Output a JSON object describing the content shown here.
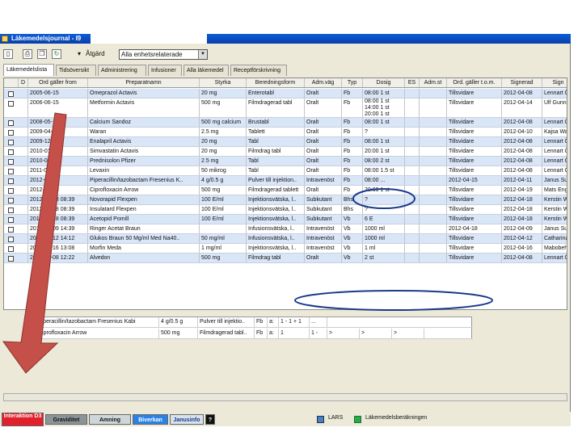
{
  "window": {
    "title": "Läkemedelsjournal - I9"
  },
  "toolbar": {
    "action_label": "Åtgärd",
    "filter_value": "Alla enhetsrelaterade"
  },
  "tabs": [
    "Läkemedelslista",
    "Tidsöversikt",
    "Administrering",
    "Infusioner",
    "Alla läkemedel",
    "Receptförskrivning"
  ],
  "grid": {
    "columns": [
      "",
      "D",
      "Ord gäller from",
      "Preparatnamn",
      "Styrka",
      "Beredningsform",
      "Adm.väg",
      "Typ",
      "Dosig",
      "ES",
      "Adm.st",
      "Ord. gäller t.o.m.",
      "Signerad",
      "Sign"
    ],
    "rows": [
      [
        "",
        "",
        "2005-06-15",
        "Omeprazol Actavis",
        "20 mg",
        "Enterotabl",
        "Oralt",
        "Fb",
        "08:00 1 st",
        "",
        "",
        "Tillsvidare",
        "2012-04-08",
        "Lennart Ö"
      ],
      [
        "",
        "",
        "2006-06-15",
        "Metformin Actavis",
        "500 mg",
        "Filmdragerad tabl",
        "Oralt",
        "Fb",
        "08:00 1 st\n14:00 1 st\n20:00 1 st",
        "",
        "",
        "Tillsvidare",
        "2012-04-14",
        "Ulf Gunnar"
      ],
      [
        "",
        "",
        "2008-05-15",
        "Calcium Sandoz",
        "500 mg calcium",
        "Brustabl",
        "Oralt",
        "Fb",
        "08:00 1 st",
        "",
        "",
        "Tillsvidare",
        "2012-04-08",
        "Lennart Ö"
      ],
      [
        "",
        "",
        "2009-04-10",
        "Waran",
        "2.5 mg",
        "Tablett",
        "Oralt",
        "Fb",
        "?",
        "",
        "",
        "Tillsvidare",
        "2012-04-10",
        "Kajsa Wall"
      ],
      [
        "",
        "",
        "2009-12-15",
        "Enalapril Actavis",
        "20 mg",
        "Tabl",
        "Oralt",
        "Fb",
        "08:00 1 st",
        "",
        "",
        "Tillsvidare",
        "2012-04-08",
        "Lennart Ö"
      ],
      [
        "",
        "",
        "2010-01-15",
        "Simvastatin Actavis",
        "20 mg",
        "Filmdrag tabl",
        "Oralt",
        "Fb",
        "20:00 1 st",
        "",
        "",
        "Tillsvidare",
        "2012-04-08",
        "Lennart Ö"
      ],
      [
        "",
        "",
        "2010-05-15",
        "Prednisolon Pfizer",
        "2.5 mg",
        "Tabl",
        "Oralt",
        "Fb",
        "08:00 2 st",
        "",
        "",
        "Tillsvidare",
        "2012-04-08",
        "Lennart Ö"
      ],
      [
        "",
        "",
        "2011-01-15",
        "Levaxin",
        "50 mikrog",
        "Tabl",
        "Oralt",
        "Fb",
        "08:00 1.5 st",
        "",
        "",
        "Tillsvidare",
        "2012-04-08",
        "Lennart Ö"
      ],
      [
        "",
        "",
        "2012-04-11",
        "Piperacillin/tazobactam Fresenius K..",
        "4 g/0.5 g",
        "Pulver till injektion..",
        "Intravenöst",
        "Fb",
        "08:00 ...",
        "",
        "",
        "2012-04-15",
        "2012-04-11",
        "Janus Sur"
      ],
      [
        "",
        "",
        "2012-04-19",
        "Ciprofloxacin Arrow",
        "500 mg",
        "Filmdragerad tablett",
        "Oralt",
        "Fb",
        "20:00 1 st",
        "",
        "",
        "Tillsvidare",
        "2012-04-19",
        "Mats Eng"
      ],
      [
        "",
        "",
        "2012-04-18 08:39",
        "Novorapid Flexpen",
        "100 E/ml",
        "Injektionsvätska, l..",
        "Subkutant",
        "Bhs",
        "?",
        "",
        "",
        "Tillsvidare",
        "2012-04-18",
        "Kerstin W"
      ],
      [
        "",
        "",
        "2012-04-18 08:39",
        "Insulatard Flexpen",
        "100 E/ml",
        "Injektionsvätska, l..",
        "Subkutant",
        "Bhs",
        "?",
        "",
        "",
        "Tillsvidare",
        "2012-04-18",
        "Kerstin W"
      ],
      [
        "",
        "",
        "2012-04-18 08:39",
        "Acetopid Pomill",
        "100 E/ml",
        "Injektionsvätska, l..",
        "Subkutant",
        "Vb",
        "6 E",
        "",
        "",
        "Tillsvidare",
        "2012-04-18",
        "Kerstin W"
      ],
      [
        "",
        "",
        "2012-04-09 14:39",
        "Ringer Acetat Braun",
        "",
        "Infusionsvätska, l..",
        "Intravenöst",
        "Vb",
        "1000 ml",
        "",
        "",
        "2012-04-18",
        "2012-04-09",
        "Janus Sur"
      ],
      [
        "",
        "",
        "2012-04-12 14:12",
        "Glukos Braun 50 Mg/ml Med Na40..",
        "50 mg/ml",
        "Infusionsvätska, l..",
        "Intravenöst",
        "Vb",
        "1000 ml",
        "",
        "",
        "Tillsvidare",
        "2012-04-12",
        "Catharina"
      ],
      [
        "",
        "",
        "2012-04-16 13:08",
        "Morfin Meda",
        "1 mg/ml",
        "Injektionsvätska, l..",
        "Intravenöst",
        "Vb",
        "1 ml",
        "",
        "",
        "Tillsvidare",
        "2012-04-16",
        "Mabobeh"
      ],
      [
        "",
        "",
        "2012-04-08 12:22",
        "Alvedon",
        "500 mg",
        "Filmdrag tabl",
        "Oralt",
        "Vb",
        "2 st",
        "",
        "",
        "Tillsvidare",
        "2012-04-08",
        "Lennart Ö"
      ]
    ]
  },
  "popup": {
    "rows": [
      [
        "Piperacillin/tazobactam Fresenius Kabi",
        "4 g/0.5 g",
        "Pulver till injektio..",
        "Fb",
        "a:",
        "1 - 1 + 1",
        "..."
      ],
      [
        "Ciprofloxacin Arrow",
        "500 mg",
        "Filmdragerad tabl..",
        "Fb",
        "a:",
        "1",
        "1 - ",
        ">",
        ">",
        ">"
      ]
    ]
  },
  "statusbar": {
    "buttons": [
      "Interaktion D3",
      "Graviditet",
      "Amning",
      "Biverkan",
      "Janusinfo",
      "?"
    ],
    "lars_label": "LARS",
    "receipt_label": "Läkemedelsberäkningen"
  },
  "colors": {
    "interaction_bg": "#e0202a",
    "graviditet_bg": "#8c9498",
    "amning_bg": "#cfd6da",
    "biverkan_bg": "#2a82e6",
    "janusinfo_bg": "#d8e2ec",
    "arrow": "#c5504a",
    "oval": "#1a3a8a"
  }
}
